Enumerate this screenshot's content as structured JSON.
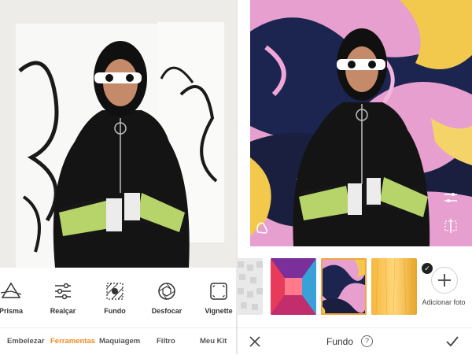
{
  "left_panel": {
    "tools": [
      {
        "label": "Prisma",
        "icon": "prism-icon"
      },
      {
        "label": "Realçar",
        "icon": "sliders-icon"
      },
      {
        "label": "Fundo",
        "icon": "background-icon"
      },
      {
        "label": "Desfocar",
        "icon": "aperture-icon"
      },
      {
        "label": "Vignette",
        "icon": "vignette-icon"
      }
    ],
    "nav": [
      {
        "label": "Embelezar",
        "active": false
      },
      {
        "label": "Ferramentas",
        "active": true
      },
      {
        "label": "Maquiagem",
        "active": false
      },
      {
        "label": "Filtro",
        "active": false
      },
      {
        "label": "Meu Kit",
        "active": false
      }
    ],
    "accent_color": "#f08a1c"
  },
  "right_panel": {
    "title": "Fundo",
    "help_symbol": "?",
    "check_symbol": "✓",
    "add_photo_label": "Adicionar foto",
    "backgrounds": [
      {
        "name": "white-tiles",
        "selected": false
      },
      {
        "name": "neon-corridor",
        "selected": false
      },
      {
        "name": "marble-pink-blue",
        "selected": true
      },
      {
        "name": "gold-texture",
        "selected": false
      }
    ],
    "selection_color": "#f3a43e"
  }
}
